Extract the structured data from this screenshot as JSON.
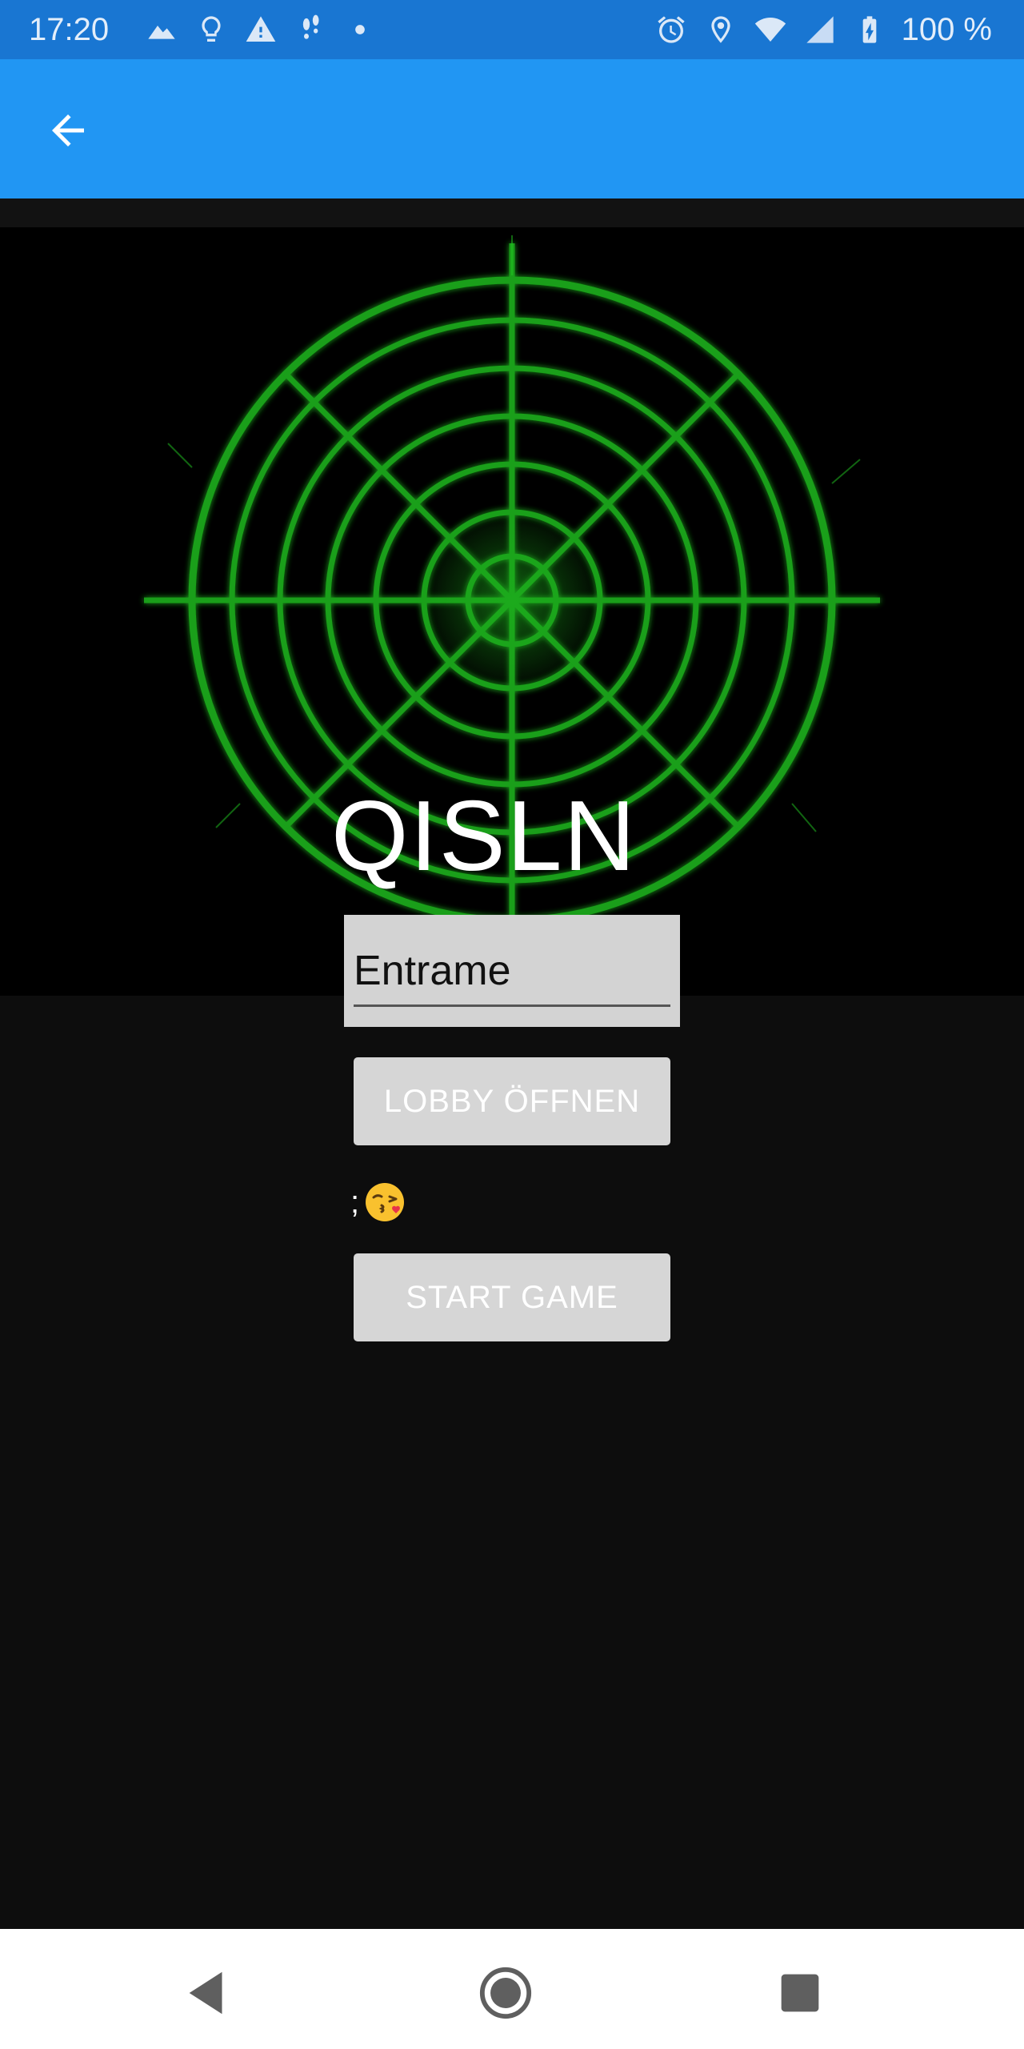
{
  "status_bar": {
    "time": "17:20",
    "battery": "100 %",
    "icons_left": [
      "mountain-icon",
      "lightbulb-icon",
      "warning-icon",
      "footsteps-icon",
      "dot-icon"
    ],
    "icons_right": [
      "alarm-icon",
      "location-icon",
      "wifi-icon",
      "signal-icon",
      "battery-icon"
    ]
  },
  "app_bar": {
    "back_icon": "arrow-left-icon"
  },
  "main": {
    "title": "QISLN",
    "name_input": {
      "value": "Entrame"
    },
    "lobby_button": "LOBBY ÖFFNEN",
    "status_text": ";",
    "status_emoji": "face-throwing-kiss-icon",
    "start_button": "START GAME"
  },
  "nav_bar": {
    "items": [
      "back-triangle-icon",
      "home-circle-icon",
      "recents-square-icon"
    ]
  },
  "colors": {
    "status_bar": "#1976d2",
    "app_bar": "#2196f3",
    "background": "#0d0d0d",
    "radar_green": "#1db31d",
    "button_bg": "#d6d6d6"
  }
}
